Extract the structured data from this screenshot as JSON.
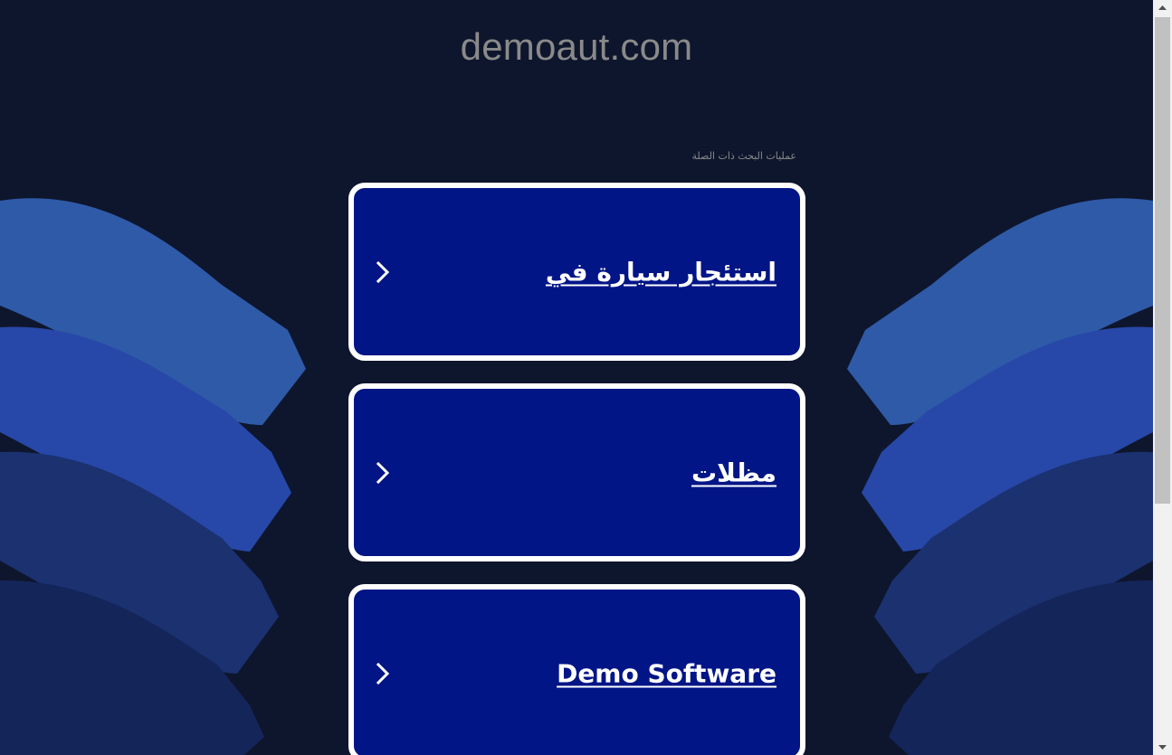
{
  "page": {
    "domain_title": "demoaut.com",
    "related_searches_label": "عمليات البحث ذات الصلة"
  },
  "cards": [
    {
      "label": "استئجار سيارة في"
    },
    {
      "label": "مظلات"
    },
    {
      "label": "Demo Software"
    }
  ],
  "icons": {
    "card_arrow": "chevron-right-icon",
    "scroll_up": "triangle-up-icon",
    "scroll_down": "triangle-down-icon"
  },
  "colors": {
    "background": "#0e162d",
    "card_fill": "#011587",
    "card_border": "#ffffff",
    "wave_light": "#2f5aa8",
    "wave_mid": "#2748a8",
    "wave_dark": "#1b3170",
    "wave_darker": "#14255a",
    "title_text": "#8a8a8a"
  }
}
